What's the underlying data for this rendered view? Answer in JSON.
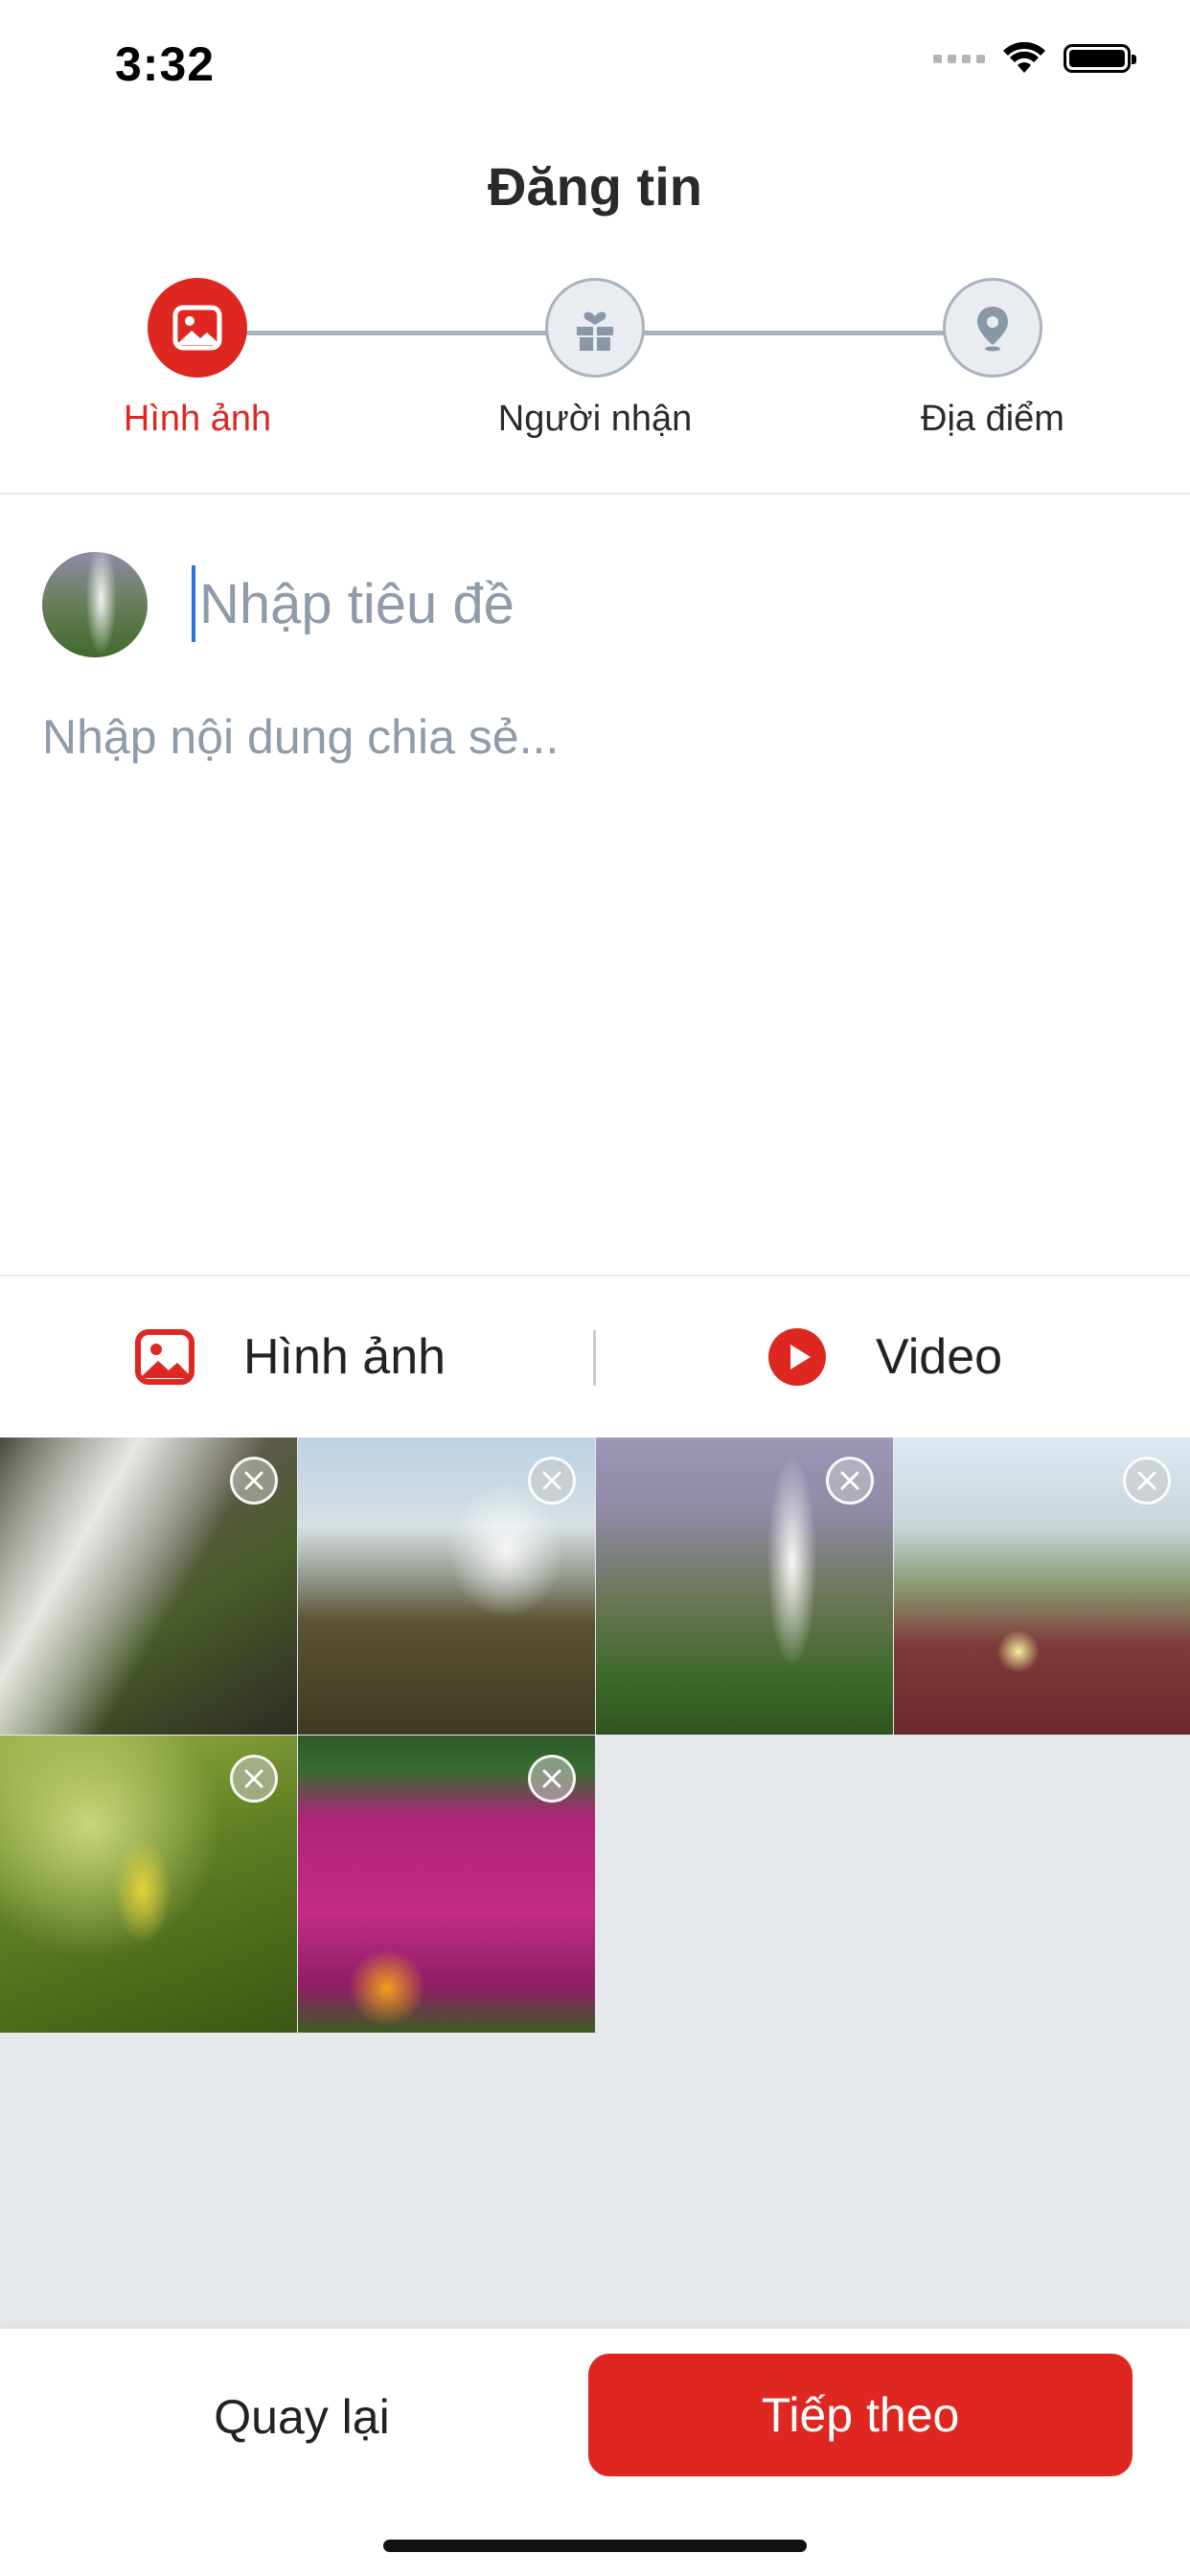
{
  "status_bar": {
    "time": "3:32"
  },
  "header": {
    "title": "Đăng tin"
  },
  "stepper": {
    "active_color": "#df2721",
    "steps": [
      {
        "label": "Hình ảnh",
        "icon": "image-icon",
        "state": "active"
      },
      {
        "label": "Người nhận",
        "icon": "gift-box-icon",
        "state": "inactive"
      },
      {
        "label": "Địa điểm",
        "icon": "location-pin-icon",
        "state": "inactive"
      }
    ]
  },
  "compose": {
    "title_placeholder": "Nhập tiêu đề",
    "title_value": "",
    "content_placeholder": "Nhập nội dung chia sẻ...",
    "content_value": ""
  },
  "media_tabs": [
    {
      "label": "Hình ảnh",
      "icon": "image-icon"
    },
    {
      "label": "Video",
      "icon": "play-circle-icon"
    }
  ],
  "photos": [
    {
      "name": "waterfall-rocks",
      "remove_icon": "close-icon"
    },
    {
      "name": "waterfall-cliff",
      "remove_icon": "close-icon"
    },
    {
      "name": "waterfall-valley",
      "remove_icon": "close-icon"
    },
    {
      "name": "dune-flower",
      "remove_icon": "close-icon"
    },
    {
      "name": "green-leaves",
      "remove_icon": "close-icon"
    },
    {
      "name": "pink-flowers",
      "remove_icon": "close-icon"
    }
  ],
  "footer": {
    "back_label": "Quay lại",
    "next_label": "Tiếp theo",
    "next_color": "#df2721"
  }
}
